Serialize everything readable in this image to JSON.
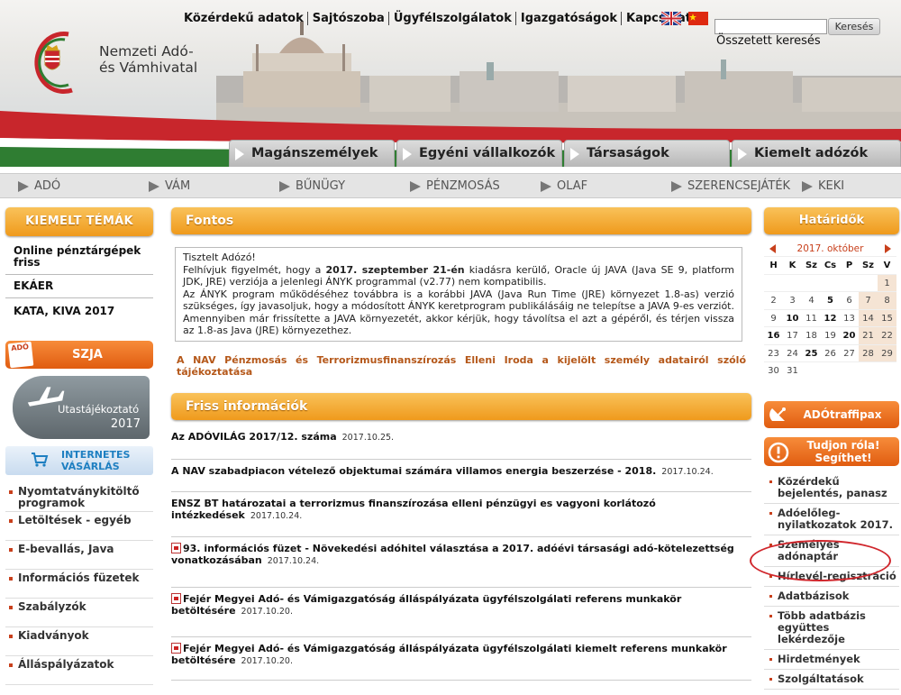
{
  "header": {
    "org_name_line1": "Nemzeti Adó-",
    "org_name_line2": "és Vámhivatal",
    "top_links": [
      "Közérdekű adatok",
      "Sajtószoba",
      "Ügyfélszolgálatok",
      "Igazgatóságok",
      "Kapcsolat"
    ],
    "search": {
      "placeholder": "",
      "button": "Keresés",
      "advanced": "Összetett keresés"
    },
    "flags": [
      "uk-flag-icon",
      "china-flag-icon"
    ]
  },
  "main_tabs": [
    "Magánszemélyek",
    "Egyéni vállalkozók",
    "Társaságok",
    "Kiemelt adózók"
  ],
  "sub_nav": [
    "ADÓ",
    "VÁM",
    "BŰNÜGY",
    "PÉNZMOSÁS",
    "OLAF",
    "SZERENCSEJÁTÉK",
    "KEKI"
  ],
  "left": {
    "featured_title": "KIEMELT TÉMÁK",
    "featured_items": [
      "Online pénztárgépek friss",
      "EKÁER",
      "KATA, KIVA 2017"
    ],
    "szja_button": "SZJA",
    "szja_badge": "ADÓ",
    "travel_banner": {
      "line1": "Utastájékoztató",
      "line2": "2017"
    },
    "shopping_banner": {
      "line1": "INTERNETES",
      "line2": "VÁSÁRLÁS"
    },
    "links": [
      "Nyomtatványkitöltő programok",
      "Letöltések - egyéb",
      "E-bevallás, Java",
      "Információs füzetek",
      "Szabályzók",
      "Kiadványok",
      "Álláspályázatok"
    ]
  },
  "center": {
    "fontos_title": "Fontos",
    "notice": {
      "greeting": "Tisztelt Adózó!",
      "p1_pre": "Felhívjuk figyelmét, hogy a ",
      "p1_date": "2017. szeptember 21-én",
      "p1_post": " kiadásra kerülő, Oracle új JAVA (Java SE 9, platform JDK, JRE) verziója a jelenlegi ÁNYK programmal (v2.77) nem kompatibilis.",
      "p2": "Az ÁNYK program működéséhez továbbra is a korábbi JAVA (Java Run Time (JRE) környezet 1.8-as) verzió szükséges, így javasoljuk, hogy a módosított ÁNYK keretprogram publikálásáig ne telepítse a JAVA 9-es verziót. Amennyiben már frissítette a JAVA környezetét, akkor kérjük, hogy távolítsa el azt a gépéről, és térjen vissza az 1.8-as Java (JRE) környezethez."
    },
    "nav_link": "A NAV Pénzmosás és Terrorizmusfinanszírozás Elleni Iroda a kijelölt személy adatairól szóló tájékoztatása",
    "friss_title": "Friss információk",
    "news": [
      {
        "title": "Az ADÓVILÁG 2017/12. száma",
        "date": "2017.10.25.",
        "pdf": false
      },
      {
        "title": "A NAV szabadpiacon vételező objektumai számára villamos energia beszerzése - 2018.",
        "date": "2017.10.24.",
        "pdf": false
      },
      {
        "title": "ENSZ BT határozatai a terrorizmus finanszírozása elleni pénzügyi es vagyoni korlátozó intézkedések",
        "date": "2017.10.24.",
        "pdf": false
      },
      {
        "title": "93. információs füzet - Növekedési adóhitel választása a 2017. adóévi társasági adó-kötelezettség vonatkozásában",
        "date": "2017.10.24.",
        "pdf": true
      },
      {
        "title": "Fejér Megyei Adó- és Vámigazgatóság álláspályázata ügyfélszolgálati referens munkakör betöltésére",
        "date": "2017.10.20.",
        "pdf": true
      },
      {
        "title": "Fejér Megyei Adó- és Vámigazgatóság álláspályázata ügyfélszolgálati kiemelt referens munkakör betöltésére",
        "date": "2017.10.20.",
        "pdf": true
      }
    ]
  },
  "right": {
    "deadline_title": "Határidők",
    "calendar": {
      "month": "2017. október",
      "days": [
        "H",
        "K",
        "Sz",
        "Cs",
        "P",
        "Sz",
        "V"
      ],
      "weeks": [
        [
          "",
          "",
          "",
          "",
          "",
          "",
          "1"
        ],
        [
          "2",
          "3",
          "4",
          "5",
          "6",
          "7",
          "8"
        ],
        [
          "9",
          "10",
          "11",
          "12",
          "13",
          "14",
          "15"
        ],
        [
          "16",
          "17",
          "18",
          "19",
          "20",
          "21",
          "22"
        ],
        [
          "23",
          "24",
          "25",
          "26",
          "27",
          "28",
          "29"
        ],
        [
          "30",
          "31",
          "",
          "",
          "",
          "",
          ""
        ]
      ],
      "bold_days": [
        "5",
        "10",
        "12",
        "16",
        "20",
        "25"
      ]
    },
    "traffipax_button": "ADÓtraffipax",
    "help_button_line1": "Tudjon róla!",
    "help_button_line2": "Segíthet!",
    "links": [
      "Közérdekű bejelentés, panasz",
      "Adóelőleg-nyilatkozatok 2017.",
      "Személyes adónaptár",
      "Hírlevél-regisztráció",
      "Adatbázisok",
      "Több adatbázis együttes lekérdezője",
      "Hirdetmények",
      "Szolgáltatások"
    ]
  },
  "colors": {
    "accent_orange": "#ef9a1c",
    "flag_red": "#c8262c",
    "flag_green": "#2f7d32",
    "highlight": "#d0262c"
  }
}
